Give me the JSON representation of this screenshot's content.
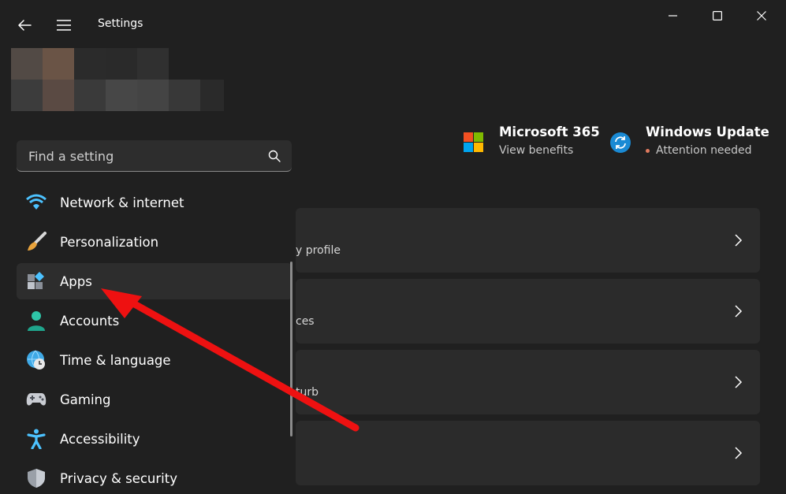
{
  "window": {
    "title": "Settings"
  },
  "search": {
    "placeholder": "Find a setting"
  },
  "nav": {
    "items": [
      {
        "label": "Network & internet",
        "icon": "wifi-icon"
      },
      {
        "label": "Personalization",
        "icon": "brush-icon"
      },
      {
        "label": "Apps",
        "icon": "apps-icon",
        "selected": true
      },
      {
        "label": "Accounts",
        "icon": "person-icon"
      },
      {
        "label": "Time & language",
        "icon": "globe-clock-icon"
      },
      {
        "label": "Gaming",
        "icon": "gamepad-icon"
      },
      {
        "label": "Accessibility",
        "icon": "accessibility-icon"
      },
      {
        "label": "Privacy & security",
        "icon": "shield-icon"
      }
    ]
  },
  "promos": {
    "ms365": {
      "title": "Microsoft 365",
      "subtitle": "View benefits",
      "icon": "microsoft-logo-icon"
    },
    "windows_update": {
      "title": "Windows Update",
      "subtitle": "Attention needed",
      "icon": "sync-icon"
    }
  },
  "cards": [
    {
      "subtitle": "y profile"
    },
    {
      "subtitle": "ces"
    },
    {
      "subtitle": "turb"
    },
    {
      "subtitle": ""
    }
  ],
  "colors": {
    "background": "#202020",
    "card": "#2b2b2b",
    "selected": "#2d2d2d",
    "accent": "#0078d4",
    "annotation_arrow": "#ee1111"
  }
}
